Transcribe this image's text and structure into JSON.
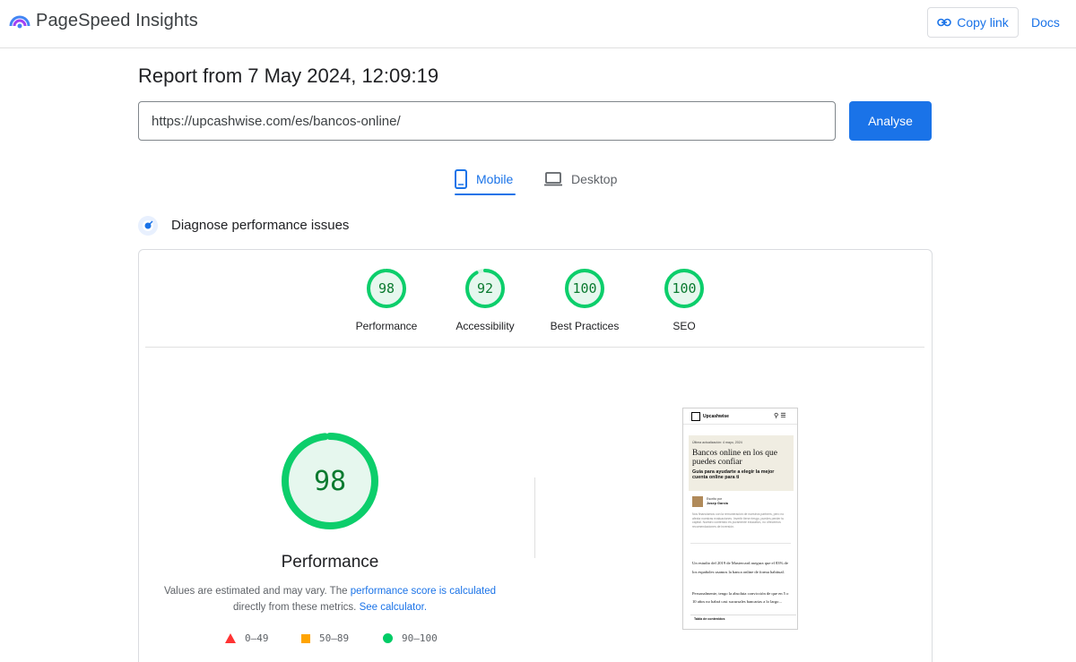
{
  "header": {
    "brand": "PageSpeed Insights",
    "copy_link": "Copy link",
    "docs": "Docs"
  },
  "report": {
    "title": "Report from 7 May 2024, 12:09:19",
    "url": "https://upcashwise.com/es/bancos-online/",
    "analyse": "Analyse"
  },
  "tabs": {
    "mobile": "Mobile",
    "desktop": "Desktop",
    "active": "mobile"
  },
  "diagnose": {
    "title": "Diagnose performance issues"
  },
  "scores": [
    {
      "label": "Performance",
      "value": "98"
    },
    {
      "label": "Accessibility",
      "value": "92"
    },
    {
      "label": "Best Practices",
      "value": "100"
    },
    {
      "label": "SEO",
      "value": "100"
    }
  ],
  "performance": {
    "score": "98",
    "title": "Performance",
    "note_pre": "Values are estimated and may vary. The ",
    "note_link1": "performance score is calculated",
    "note_mid": " directly from these metrics. ",
    "note_link2": "See calculator."
  },
  "legend": [
    {
      "shape": "triangle",
      "range": "0–49",
      "color": "#ff3333"
    },
    {
      "shape": "square",
      "range": "50–89",
      "color": "#ffa400"
    },
    {
      "shape": "circle",
      "range": "90–100",
      "color": "#00cc66"
    }
  ],
  "thumbnail": {
    "logo": "Upcashwise",
    "date": "Última actualización: 4 mayo, 2024",
    "headline": "Bancos online en los que puedes confiar",
    "subhead": "Guía para ayudarte a elegir la mejor cuenta online para ti",
    "author_label": "Escrito por",
    "author": "Josep Garcia",
    "disclaimer": "Nos financiamos con la remuneración de nuestros partners, pero no afecta nuestras evaluaciones. Invertir tiene riesgo, puedes perder tu capital. Nuestro contenido es puramente educativo, no ofrecemos recomendaciones de inversión.",
    "para1": "Un estudio del 2019 de Mastercard asegura que el 83% de los españoles usamos la banca online de forma habitual.",
    "para2": "Personalmente, tengo la absoluta convicción de que en 5 o 10 años no habrá casi sucursales bancarias a lo largo...",
    "toc": "Tabla de contenidos"
  },
  "colors": {
    "accent": "#1a73e8",
    "pass": "#0cce6b",
    "pass_text": "#0a7a2f",
    "pass_fill": "#e6f7ee"
  }
}
